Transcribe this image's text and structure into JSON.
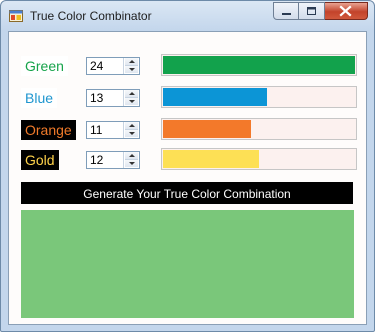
{
  "window": {
    "title": "True Color Combinator",
    "icons": {
      "app": "app-window-icon",
      "minimize": "minimize-icon",
      "maximize": "maximize-icon",
      "close": "close-icon"
    }
  },
  "rows": [
    {
      "label": "Green",
      "value": "24",
      "fraction": 1.0,
      "label_color": "#16a34a",
      "label_bg": "#ffffff",
      "bar_color": "#12a24c"
    },
    {
      "label": "Blue",
      "value": "13",
      "fraction": 0.543,
      "label_color": "#1f96cf",
      "label_bg": "#ffffff",
      "bar_color": "#0c95d6"
    },
    {
      "label": "Orange",
      "value": "11",
      "fraction": 0.456,
      "label_color": "#f07a2a",
      "label_bg": "#000000",
      "bar_color": "#f3792a"
    },
    {
      "label": "Gold",
      "value": "12",
      "fraction": 0.5,
      "label_color": "#ffd24a",
      "label_bg": "#000000",
      "bar_color": "#fde055"
    }
  ],
  "generate_button": {
    "label": "Generate Your True Color Combination"
  },
  "result": {
    "color": "#7ac77a"
  }
}
